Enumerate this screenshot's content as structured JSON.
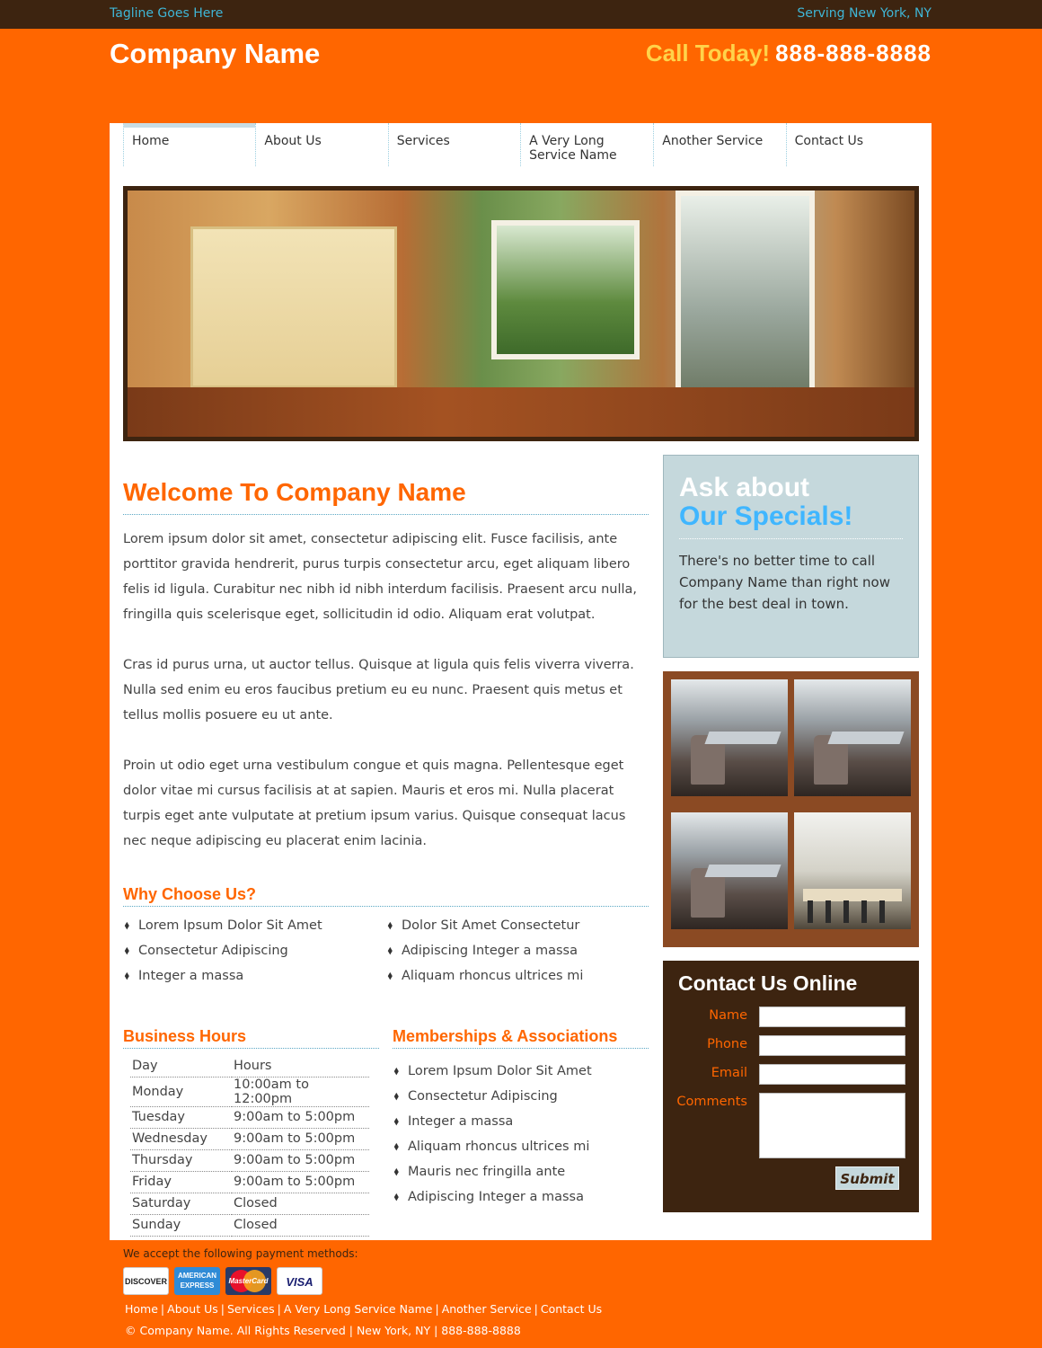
{
  "topbar": {
    "tagline": "Tagline Goes Here",
    "serving": "Serving New York, NY"
  },
  "header": {
    "company": "Company Name",
    "call_label": "Call Today!",
    "phone": "888-888-8888"
  },
  "nav": [
    {
      "label": "Home"
    },
    {
      "label": "About Us"
    },
    {
      "label": "Services"
    },
    {
      "label": "A Very Long Service Name"
    },
    {
      "label": "Another Service"
    },
    {
      "label": "Contact Us"
    }
  ],
  "welcome": {
    "title": "Welcome To Company Name",
    "paragraphs": [
      "Lorem ipsum dolor sit amet, consectetur adipiscing elit. Fusce facilisis, ante porttitor gravida hendrerit, purus turpis consectetur arcu, eget aliquam libero felis id ligula. Curabitur nec nibh id nibh interdum facilisis. Praesent arcu nulla, fringilla quis scelerisque eget, sollicitudin id odio. Aliquam erat volutpat.",
      "Cras id purus urna, ut auctor tellus. Quisque at ligula quis felis viverra viverra. Nulla sed enim eu eros faucibus pretium eu eu nunc. Praesent quis metus et tellus mollis posuere eu ut ante.",
      "Proin ut odio eget urna vestibulum congue et quis magna. Pellentesque eget dolor vitae mi cursus facilisis at at sapien. Mauris et eros mi. Nulla placerat turpis eget ante vulputate at pretium ipsum varius. Quisque consequat lacus nec neque adipiscing eu placerat enim lacinia."
    ]
  },
  "why": {
    "title": "Why Choose Us?",
    "col1": [
      "Lorem Ipsum Dolor Sit Amet",
      "Consectetur Adipiscing",
      "Integer a massa"
    ],
    "col2": [
      "Dolor Sit Amet Consectetur",
      "Adipiscing Integer a massa",
      "Aliquam rhoncus ultrices mi"
    ]
  },
  "hours": {
    "title": "Business Hours",
    "header": {
      "day": "Day",
      "hours": "Hours"
    },
    "rows": [
      {
        "day": "Monday",
        "hours": "10:00am to 12:00pm"
      },
      {
        "day": "Tuesday",
        "hours": "9:00am to 5:00pm"
      },
      {
        "day": "Wednesday",
        "hours": "9:00am to 5:00pm"
      },
      {
        "day": "Thursday",
        "hours": "9:00am to 5:00pm"
      },
      {
        "day": "Friday",
        "hours": "9:00am to 5:00pm"
      },
      {
        "day": "Saturday",
        "hours": "Closed"
      },
      {
        "day": "Sunday",
        "hours": "Closed"
      }
    ]
  },
  "memberships": {
    "title": "Memberships & Associations",
    "items": [
      "Lorem Ipsum Dolor Sit Amet",
      "Consectetur Adipiscing",
      "Integer a massa",
      "Aliquam rhoncus ultrices mi",
      "Mauris nec fringilla ante",
      "Adipiscing Integer a massa"
    ]
  },
  "specials": {
    "line1": "Ask about",
    "line2": "Our Specials!",
    "text": "There's no better time to call Company Name than right now for the best deal in town."
  },
  "contact": {
    "title": "Contact Us Online",
    "labels": {
      "name": "Name",
      "phone": "Phone",
      "email": "Email",
      "comments": "Comments"
    },
    "submit": "Submit"
  },
  "footer": {
    "payment_text": "We accept the following payment methods:",
    "cards": {
      "discover": "DISCOVER",
      "amex_1": "AMERICAN",
      "amex_2": "EXPRESS",
      "mc": "MasterCard",
      "visa": "VISA"
    },
    "links": [
      "Home",
      "About Us",
      "Services",
      "A Very Long Service Name",
      "Another Service",
      "Contact Us"
    ],
    "copyright": "© Company Name. All Rights Reserved | New York, NY | 888-888-8888"
  },
  "colors": {
    "brand_orange": "#ff6600",
    "dark_brown": "#3d2410",
    "accent_blue": "#3fb6d6",
    "specials_bg": "#c5d8dc"
  }
}
